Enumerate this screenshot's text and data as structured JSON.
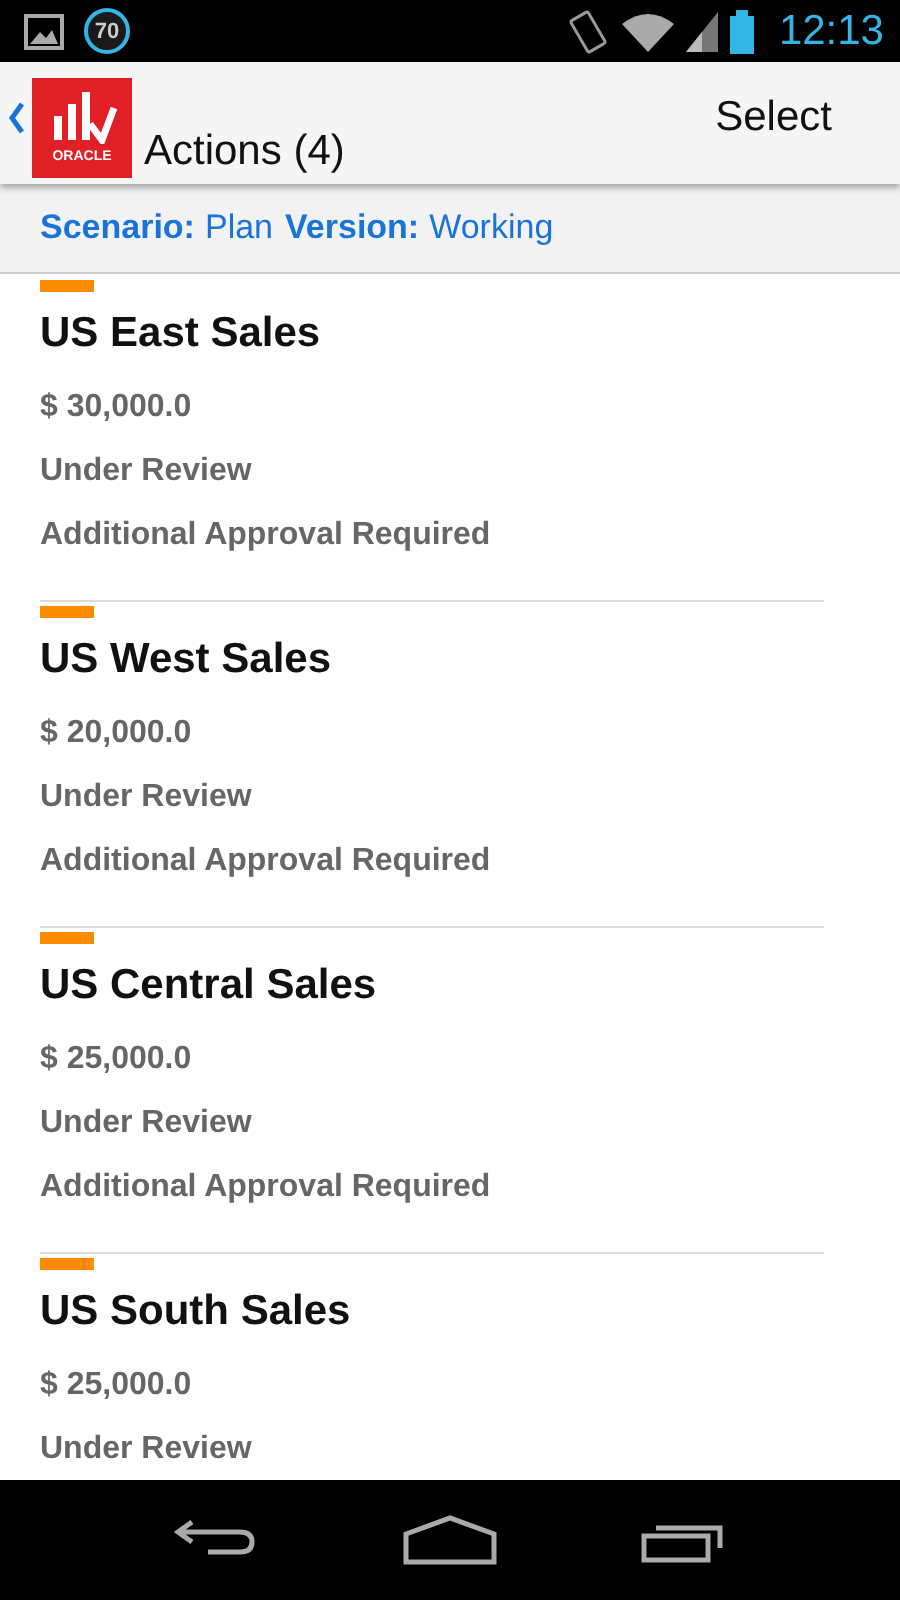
{
  "status_bar": {
    "badge": "70",
    "time": "12:13"
  },
  "header": {
    "logo_text": "ORACLE",
    "title": "Actions (4)",
    "action": "Select"
  },
  "filter": [
    {
      "label": "Scenario:",
      "value": "Plan"
    },
    {
      "label": "Version:",
      "value": "Working"
    }
  ],
  "actions": [
    {
      "name": "US East Sales",
      "amount": "$ 30,000.0",
      "status": "Under Review",
      "note": "Additional Approval Required",
      "color": "#ff8c00"
    },
    {
      "name": "US West Sales",
      "amount": "$ 20,000.0",
      "status": "Under Review",
      "note": "Additional Approval Required",
      "color": "#ff8c00"
    },
    {
      "name": "US Central Sales",
      "amount": "$ 25,000.0",
      "status": "Under Review",
      "note": "Additional Approval Required",
      "color": "#ff8c00"
    },
    {
      "name": "US South Sales",
      "amount": "$ 25,000.0",
      "status": "Under Review",
      "color": "#ff8c00"
    }
  ]
}
